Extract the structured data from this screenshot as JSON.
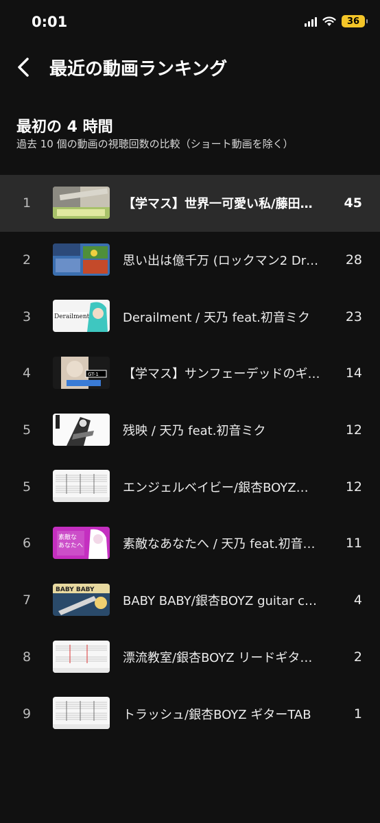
{
  "status_bar": {
    "time": "0:01",
    "battery": "36"
  },
  "header": {
    "title": "最近の動画ランキング"
  },
  "section": {
    "title": "最初の 4 時間",
    "subtitle": "過去 10 個の動画の視聴回数の比較（ショート動画を除く）"
  },
  "rows": [
    {
      "rank": "1",
      "title": "【学マス】世界一可愛い私/藤田…",
      "count": "45",
      "thumb": "guitar-closeup",
      "highlight": true
    },
    {
      "rank": "2",
      "title": "思い出は億千万 (ロックマン2 Dr…",
      "count": "28",
      "thumb": "game-collage"
    },
    {
      "rank": "3",
      "title": "Derailment / 天乃 feat.初音ミク",
      "count": "23",
      "thumb": "derailment"
    },
    {
      "rank": "4",
      "title": "【学マス】サンフェーデッドのギ…",
      "count": "14",
      "thumb": "gt1-anime"
    },
    {
      "rank": "5",
      "title": "残映 / 天乃 feat.初音ミク",
      "count": "12",
      "thumb": "manga-bw"
    },
    {
      "rank": "5",
      "title": "エンジェルベイビー/銀杏BOYZ…",
      "count": "12",
      "thumb": "tab-sheet"
    },
    {
      "rank": "6",
      "title": "素敵なあなたへ / 天乃 feat.初音…",
      "count": "11",
      "thumb": "magenta-text"
    },
    {
      "rank": "7",
      "title": "BABY BABY/銀杏BOYZ guitar c…",
      "count": "4",
      "thumb": "baby-baby"
    },
    {
      "rank": "8",
      "title": "漂流教室/銀杏BOYZ リードギタ…",
      "count": "2",
      "thumb": "tab-sheet-red"
    },
    {
      "rank": "9",
      "title": "トラッシュ/銀杏BOYZ ギターTAB",
      "count": "1",
      "thumb": "tab-sheet"
    }
  ]
}
